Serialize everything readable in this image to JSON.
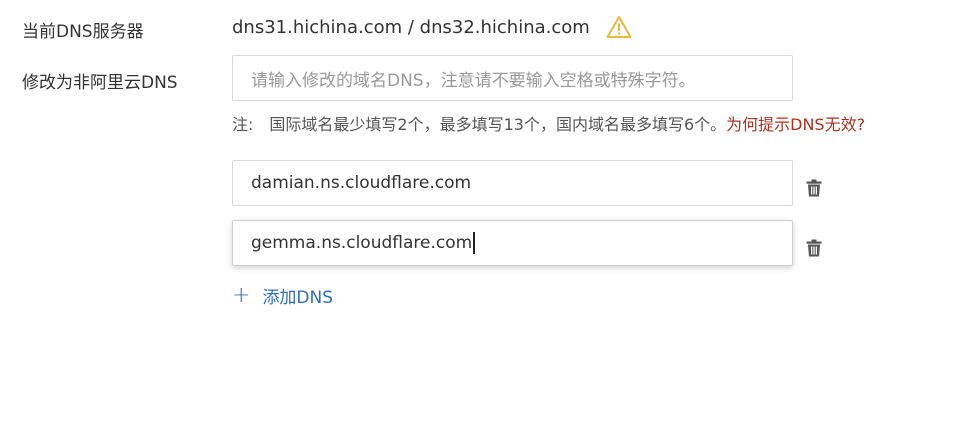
{
  "current_dns": {
    "label": "当前DNS服务器",
    "value": "dns31.hichina.com / dns32.hichina.com",
    "warning_icon": "warning-triangle-icon",
    "warning_color": "#e8b93e"
  },
  "modify": {
    "label": "修改为非阿里云DNS",
    "input_placeholder": "请输入修改的域名DNS，注意请不要输入空格或特殊字符。",
    "note_prefix": "注:",
    "note_text": "国际域名最少填写2个，最多填写13个，国内域名最多填写6个。",
    "help_link": "为何提示DNS无效?",
    "help_link_color": "#a8331f"
  },
  "dns_entries": [
    {
      "value": "damian.ns.cloudflare.com",
      "delete_icon": "trash-icon"
    },
    {
      "value": "gemma.ns.cloudflare.com",
      "delete_icon": "trash-icon"
    }
  ],
  "add_dns": {
    "icon": "plus-icon",
    "label": "添加DNS",
    "color": "#2f6fba"
  }
}
